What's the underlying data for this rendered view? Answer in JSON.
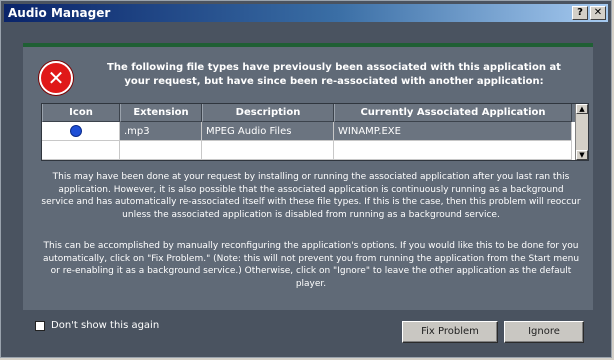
{
  "window": {
    "title": "Audio Manager",
    "help_label": "?",
    "close_label": "✕"
  },
  "headline": "The following file types have previously been associated with this application at your request, but have since been re-associated with another application:",
  "table": {
    "columns": [
      "Icon",
      "Extension",
      "Description",
      "Currently Associated Application"
    ],
    "rows": [
      {
        "icon": "audio-file-icon",
        "extension": ".mp3",
        "description": "MPEG Audio Files",
        "application": "WINAMP.EXE"
      }
    ]
  },
  "paragraphs": {
    "p1": "This may have been done at your request by installing or running the associated application after you last ran this application. However, it is also possible that the associated application is continuously running as a background service and has automatically re-associated itself with these file types. If this is the case, then this problem will reoccur unless the associated application is disabled from running as a background service.",
    "p2": "This can be accomplished by manually reconfiguring the application's options. If you would like this to be done for you automatically, click on \"Fix Problem.\" (Note: this will not prevent you from running the application from the Start menu or re-enabling it as a background service.) Otherwise, click on \"Ignore\" to leave the other application as the default player."
  },
  "checkbox": {
    "label": "Don't show this again",
    "checked": false
  },
  "buttons": {
    "fix": "Fix Problem",
    "ignore": "Ignore"
  },
  "icons": {
    "error": "error-icon"
  },
  "colors": {
    "title_start": "#0a246a",
    "error_red": "#e01818",
    "panel": "#606a77",
    "accent_green": "#1f5f34"
  }
}
